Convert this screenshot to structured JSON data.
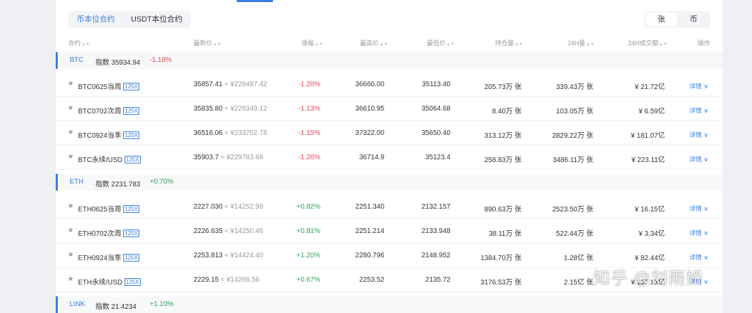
{
  "tabs": [
    {
      "label": "币本位合约",
      "active": true
    },
    {
      "label": "USDT本位合约",
      "active": false
    }
  ],
  "unit_toggle": {
    "options": [
      "张",
      "币"
    ],
    "selected": "张"
  },
  "columns": {
    "contract": "合约",
    "last_price": "最新价",
    "change": "涨幅",
    "high": "最高价",
    "low": "最低价",
    "open_interest": "持仓量",
    "volume_24h": "24H量",
    "turnover_24h": "24H成交额",
    "action": "操作"
  },
  "index_label": "指数",
  "sort_icon": "sort-icon",
  "groups": [
    {
      "code": "BTC",
      "index_value": "35934.94",
      "index_change": "-1.18%",
      "index_change_color": "#e04a59",
      "rows": [
        {
          "name": "BTC0625当周",
          "leverage": "125X",
          "last": "35857.41",
          "cny": "≈ ¥229487.42",
          "change": "-1.20%",
          "change_color": "#e04a59",
          "high": "36660.00",
          "low": "35113.40",
          "oi": "205.73万 张",
          "vol": "339.43万 张",
          "turnover": "¥ 21.72亿",
          "action": "详情"
        },
        {
          "name": "BTC0702次周",
          "leverage": "125X",
          "last": "35835.80",
          "cny": "≈ ¥229349.12",
          "change": "-1.13%",
          "change_color": "#e04a59",
          "high": "36610.95",
          "low": "35064.68",
          "oi": "8.40万 张",
          "vol": "103.05万 张",
          "turnover": "¥ 6.59亿",
          "action": "详情"
        },
        {
          "name": "BTC0924当季",
          "leverage": "125X",
          "last": "36516.06",
          "cny": "≈ ¥233702.78",
          "change": "-1.15%",
          "change_color": "#e04a59",
          "high": "37322.00",
          "low": "35650.40",
          "oi": "313.12万 张",
          "vol": "2829.22万 张",
          "turnover": "¥ 181.07亿",
          "action": "详情"
        },
        {
          "name": "BTC永续/USD",
          "leverage": "125X",
          "last": "35903.7",
          "cny": "≈ ¥229783.68",
          "change": "-1.26%",
          "change_color": "#e04a59",
          "high": "36714.9",
          "low": "35123.4",
          "oi": "258.83万 张",
          "vol": "3486.11万 张",
          "turnover": "¥ 223.11亿",
          "action": "详情"
        }
      ]
    },
    {
      "code": "ETH",
      "index_value": "2231.783",
      "index_change": "+0.70%",
      "index_change_color": "#2fa35a",
      "rows": [
        {
          "name": "ETH0625当周",
          "leverage": "125X",
          "last": "2227.030",
          "cny": "≈ ¥14252.99",
          "change": "+0.82%",
          "change_color": "#2fa35a",
          "high": "2251.340",
          "low": "2132.157",
          "oi": "890.63万 张",
          "vol": "2523.50万 张",
          "turnover": "¥ 16.15亿",
          "action": "详情"
        },
        {
          "name": "ETH0702次周",
          "leverage": "125X",
          "last": "2226.635",
          "cny": "≈ ¥14250.46",
          "change": "+0.81%",
          "change_color": "#2fa35a",
          "high": "2251.214",
          "low": "2133.948",
          "oi": "38.11万 张",
          "vol": "522.44万 张",
          "turnover": "¥ 3.34亿",
          "action": "详情"
        },
        {
          "name": "ETH0924当季",
          "leverage": "125X",
          "last": "2253.813",
          "cny": "≈ ¥14424.40",
          "change": "+1.20%",
          "change_color": "#2fa35a",
          "high": "2280.796",
          "low": "2148.952",
          "oi": "1384.70万 张",
          "vol": "1.28亿 张",
          "turnover": "¥ 82.44亿",
          "action": "详情"
        },
        {
          "name": "ETH永续/USD",
          "leverage": "125X",
          "last": "2229.15",
          "cny": "≈ ¥14266.56",
          "change": "+0.67%",
          "change_color": "#2fa35a",
          "high": "2253.52",
          "low": "2135.72",
          "oi": "3176.53万 张",
          "vol": "2.15亿 张",
          "turnover": "¥ 137.13亿",
          "action": "详情"
        }
      ]
    },
    {
      "code": "LINK",
      "index_value": "21.4234",
      "index_change": "+1.10%",
      "index_change_color": "#2fa35a",
      "rows": []
    }
  ],
  "watermark": "知乎 @刘雨娇"
}
